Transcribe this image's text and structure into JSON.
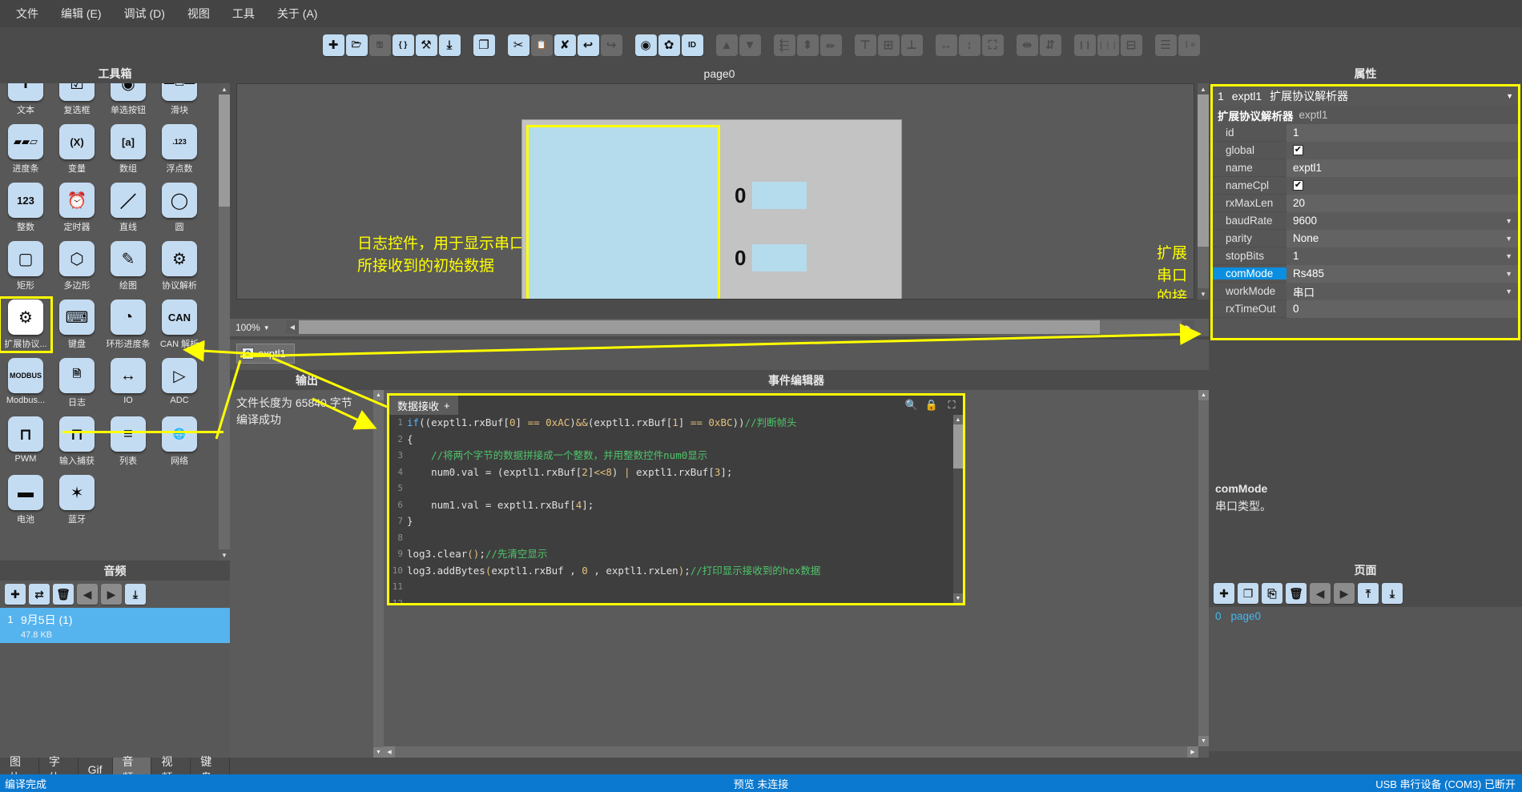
{
  "menubar": {
    "items": [
      "文件",
      "编辑 (E)",
      "调试 (D)",
      "视图",
      "工具",
      "关于 (A)"
    ]
  },
  "toolbar": {
    "buttons": [
      {
        "name": "new-icon",
        "glyph": "✚",
        "enabled": true
      },
      {
        "name": "open-folder-icon",
        "glyph": "🗁",
        "enabled": true
      },
      {
        "name": "save-icon",
        "glyph": "🖫",
        "enabled": false
      },
      {
        "name": "braces-icon",
        "glyph": "{ }",
        "enabled": true
      },
      {
        "name": "build-icon",
        "glyph": "⚒",
        "enabled": true
      },
      {
        "name": "download-icon",
        "glyph": "⤓",
        "enabled": true
      },
      {
        "name": "copy-icon",
        "glyph": "❐",
        "enabled": true
      },
      {
        "name": "cut-icon",
        "glyph": "✂",
        "enabled": true
      },
      {
        "name": "paste-icon",
        "glyph": "📋",
        "enabled": false
      },
      {
        "name": "delete-icon",
        "glyph": "✘",
        "enabled": true
      },
      {
        "name": "undo-icon",
        "glyph": "↩",
        "enabled": true
      },
      {
        "name": "redo-icon",
        "glyph": "↪",
        "enabled": false
      },
      {
        "name": "preview-icon",
        "glyph": "◉",
        "enabled": true
      },
      {
        "name": "settings-gear-icon",
        "glyph": "✿",
        "enabled": true
      },
      {
        "name": "id-icon",
        "glyph": "ID",
        "enabled": true
      },
      {
        "name": "move-up-icon",
        "glyph": "▲",
        "enabled": false
      },
      {
        "name": "move-down-icon",
        "glyph": "▼",
        "enabled": false
      },
      {
        "name": "align-left-icon",
        "glyph": "⬱",
        "enabled": false
      },
      {
        "name": "align-center-h-icon",
        "glyph": "⬍",
        "enabled": false
      },
      {
        "name": "align-right-icon",
        "glyph": "⬰",
        "enabled": false
      },
      {
        "name": "align-top-icon",
        "glyph": "⊤",
        "enabled": false
      },
      {
        "name": "align-middle-v-icon",
        "glyph": "⊞",
        "enabled": false
      },
      {
        "name": "align-bottom-icon",
        "glyph": "⊥",
        "enabled": false
      },
      {
        "name": "same-width-icon",
        "glyph": "↔",
        "enabled": false
      },
      {
        "name": "same-height-icon",
        "glyph": "↕",
        "enabled": false
      },
      {
        "name": "fit-size-icon",
        "glyph": "⛶",
        "enabled": false
      },
      {
        "name": "distribute-h-icon",
        "glyph": "⇹",
        "enabled": false
      },
      {
        "name": "distribute-v-icon",
        "glyph": "⇵",
        "enabled": false
      },
      {
        "name": "group-icon",
        "glyph": "❙❙",
        "enabled": false
      },
      {
        "name": "ungroup-icon",
        "glyph": "❘❘❘",
        "enabled": false
      },
      {
        "name": "lock-icon",
        "glyph": "⊟",
        "enabled": false
      },
      {
        "name": "list-order-icon",
        "glyph": "☰",
        "enabled": false
      },
      {
        "name": "list-number-icon",
        "glyph": "⋮≡",
        "enabled": false
      }
    ]
  },
  "toolbox": {
    "title": "工具箱",
    "items": [
      {
        "label": "文本",
        "glyph": "T",
        "selected": false
      },
      {
        "label": "复选框",
        "glyph": "☑",
        "selected": false
      },
      {
        "label": "单选按钮",
        "glyph": "◉",
        "selected": false
      },
      {
        "label": "滑块",
        "glyph": "—▭—",
        "selected": false
      },
      {
        "label": "进度条",
        "glyph": "▰▰▱",
        "selected": false
      },
      {
        "label": "变量",
        "glyph": "(X)",
        "selected": false
      },
      {
        "label": "数组",
        "glyph": "[a]",
        "selected": false
      },
      {
        "label": "浮点数",
        "glyph": ".123",
        "selected": false
      },
      {
        "label": "整数",
        "glyph": "123",
        "selected": false
      },
      {
        "label": "定时器",
        "glyph": "⏰",
        "selected": false
      },
      {
        "label": "直线",
        "glyph": "／",
        "selected": false
      },
      {
        "label": "圆",
        "glyph": "◯",
        "selected": false
      },
      {
        "label": "矩形",
        "glyph": "▢",
        "selected": false
      },
      {
        "label": "多边形",
        "glyph": "⬡",
        "selected": false
      },
      {
        "label": "绘图",
        "glyph": "✎",
        "selected": false
      },
      {
        "label": "协议解析",
        "glyph": "⚙",
        "selected": false
      },
      {
        "label": "扩展协议...",
        "glyph": "⚙",
        "selected": true
      },
      {
        "label": "键盘",
        "glyph": "⌨",
        "selected": false
      },
      {
        "label": "环形进度条",
        "glyph": "◔",
        "selected": false
      },
      {
        "label": "CAN 解析",
        "glyph": "CAN",
        "selected": false
      },
      {
        "label": "Modbus...",
        "glyph": "MODBUS",
        "selected": false
      },
      {
        "label": "日志",
        "glyph": "🗎",
        "selected": false
      },
      {
        "label": "IO",
        "glyph": "↔",
        "selected": false
      },
      {
        "label": "ADC",
        "glyph": "▷",
        "selected": false
      },
      {
        "label": "PWM",
        "glyph": "⊓",
        "selected": false
      },
      {
        "label": "输入捕获",
        "glyph": "⊓",
        "selected": false
      },
      {
        "label": "列表",
        "glyph": "≡",
        "selected": false
      },
      {
        "label": "网络",
        "glyph": "🌐",
        "selected": false
      },
      {
        "label": "电池",
        "glyph": "▬",
        "selected": false
      },
      {
        "label": "蓝牙",
        "glyph": "✶",
        "selected": false
      }
    ]
  },
  "audio": {
    "title": "音频",
    "buttons": [
      {
        "name": "add-audio-button",
        "glyph": "✚",
        "gray": false
      },
      {
        "name": "replace-audio-button",
        "glyph": "⇄",
        "gray": false
      },
      {
        "name": "delete-audio-button",
        "glyph": "🗑",
        "gray": false
      },
      {
        "name": "move-prev-button",
        "glyph": "◀",
        "gray": true
      },
      {
        "name": "move-next-button",
        "glyph": "▶",
        "gray": true
      },
      {
        "name": "export-audio-button",
        "glyph": "⤓",
        "gray": false
      }
    ],
    "items": [
      {
        "index": "1",
        "name": "9月5日 (1)",
        "size": "47.8 KB",
        "selected": true
      }
    ]
  },
  "asset_tabs": {
    "items": [
      "图片",
      "字体",
      "Gif",
      "音频",
      "视频",
      "键盘"
    ],
    "active": "音频"
  },
  "canvas": {
    "title": "page0",
    "zoom": "100%",
    "annotation_left": "日志控件，用于显示串口\n所接收到的初始数据",
    "annotation_right": "扩展串口的接口设置在控件属性内\n主串口的接口设置在项目设置内",
    "num0_value": "0",
    "num1_value": "0",
    "object_chip": "exptl1"
  },
  "output": {
    "title": "输出",
    "lines": [
      "文件长度为 65840 字节",
      "编译成功"
    ]
  },
  "events": {
    "title": "事件编辑器",
    "tab_label": "数据接收",
    "tab_add": "+",
    "tools": [
      {
        "name": "search-icon",
        "glyph": "🔍"
      },
      {
        "name": "lock-icon",
        "glyph": "🔒"
      },
      {
        "name": "expand-icon",
        "glyph": "⛶"
      }
    ],
    "code_lines": [
      {
        "n": "1",
        "tokens": [
          {
            "t": "kw",
            "v": "if"
          },
          {
            "t": "txt",
            "v": "(("
          },
          {
            "t": "txt",
            "v": "exptl1.rxBuf["
          },
          {
            "t": "num",
            "v": "0"
          },
          {
            "t": "txt",
            "v": "] "
          },
          {
            "t": "op",
            "v": "=="
          },
          {
            "t": "txt",
            "v": " "
          },
          {
            "t": "num",
            "v": "0xAC"
          },
          {
            "t": "txt",
            "v": ")"
          },
          {
            "t": "op",
            "v": "&&"
          },
          {
            "t": "txt",
            "v": "(exptl1.rxBuf["
          },
          {
            "t": "num",
            "v": "1"
          },
          {
            "t": "txt",
            "v": "] "
          },
          {
            "t": "op",
            "v": "=="
          },
          {
            "t": "txt",
            "v": " "
          },
          {
            "t": "num",
            "v": "0xBC"
          },
          {
            "t": "txt",
            "v": "))"
          },
          {
            "t": "cmt",
            "v": "//判断帧头"
          }
        ]
      },
      {
        "n": "2",
        "tokens": [
          {
            "t": "txt",
            "v": "{"
          }
        ]
      },
      {
        "n": "3",
        "tokens": [
          {
            "t": "cmt",
            "v": "    //将两个字节的数据拼接成一个整数，并用整数控件num0显示"
          }
        ]
      },
      {
        "n": "4",
        "tokens": [
          {
            "t": "txt",
            "v": "    num0.val = (exptl1.rxBuf["
          },
          {
            "t": "num",
            "v": "2"
          },
          {
            "t": "txt",
            "v": "]"
          },
          {
            "t": "op",
            "v": "<<"
          },
          {
            "t": "num",
            "v": "8"
          },
          {
            "t": "txt",
            "v": ") "
          },
          {
            "t": "op",
            "v": "|"
          },
          {
            "t": "txt",
            "v": " exptl1.rxBuf["
          },
          {
            "t": "num",
            "v": "3"
          },
          {
            "t": "txt",
            "v": "];"
          }
        ]
      },
      {
        "n": "5",
        "tokens": []
      },
      {
        "n": "6",
        "tokens": [
          {
            "t": "txt",
            "v": "    num1.val = exptl1.rxBuf["
          },
          {
            "t": "num",
            "v": "4"
          },
          {
            "t": "txt",
            "v": "];"
          }
        ]
      },
      {
        "n": "7",
        "tokens": [
          {
            "t": "txt",
            "v": "}"
          }
        ]
      },
      {
        "n": "8",
        "tokens": []
      },
      {
        "n": "9",
        "tokens": [
          {
            "t": "txt",
            "v": "log3.clear"
          },
          {
            "t": "op",
            "v": "()"
          },
          {
            "t": "txt",
            "v": ";"
          },
          {
            "t": "cmt",
            "v": "//先清空显示"
          }
        ]
      },
      {
        "n": "10",
        "tokens": [
          {
            "t": "txt",
            "v": "log3.addBytes"
          },
          {
            "t": "op",
            "v": "("
          },
          {
            "t": "txt",
            "v": "exptl1.rxBuf , "
          },
          {
            "t": "num",
            "v": "0"
          },
          {
            "t": "txt",
            "v": " , exptl1.rxLen"
          },
          {
            "t": "op",
            "v": ")"
          },
          {
            "t": "txt",
            "v": ";"
          },
          {
            "t": "cmt",
            "v": "//打印显示接收到的hex数据"
          }
        ]
      },
      {
        "n": "11",
        "tokens": []
      },
      {
        "n": "12",
        "tokens": []
      },
      {
        "n": "13",
        "tokens": []
      }
    ]
  },
  "properties": {
    "title": "属性",
    "selected_id": "1",
    "selected_name": "exptl1",
    "selected_type": "扩展协议解析器",
    "header_type": "扩展协议解析器",
    "header_name": "exptl1",
    "rows": [
      {
        "key": "id",
        "value": "1",
        "type": "text",
        "selected": false
      },
      {
        "key": "global",
        "value": "✔",
        "type": "checkbox",
        "selected": false
      },
      {
        "key": "name",
        "value": "exptl1",
        "type": "text",
        "selected": false
      },
      {
        "key": "nameCpl",
        "value": "✔",
        "type": "checkbox",
        "selected": false
      },
      {
        "key": "rxMaxLen",
        "value": "20",
        "type": "text",
        "selected": false
      },
      {
        "key": "baudRate",
        "value": "9600",
        "type": "combo",
        "selected": false
      },
      {
        "key": "parity",
        "value": "None",
        "type": "combo",
        "selected": false
      },
      {
        "key": "stopBits",
        "value": "1",
        "type": "combo",
        "selected": false
      },
      {
        "key": "comMode",
        "value": "Rs485",
        "type": "combo",
        "selected": true
      },
      {
        "key": "workMode",
        "value": "串口",
        "type": "combo",
        "selected": false
      },
      {
        "key": "rxTimeOut",
        "value": "0",
        "type": "text",
        "selected": false
      }
    ],
    "help_title": "comMode",
    "help_text": "串口类型。"
  },
  "pages": {
    "title": "页面",
    "buttons": [
      {
        "name": "add-page-button",
        "glyph": "✚",
        "gray": false
      },
      {
        "name": "copy-page-button",
        "glyph": "❐",
        "gray": false
      },
      {
        "name": "paste-page-button",
        "glyph": "⎘",
        "gray": false
      },
      {
        "name": "delete-page-button",
        "glyph": "🗑",
        "gray": false
      },
      {
        "name": "page-prev-button",
        "glyph": "◀",
        "gray": true
      },
      {
        "name": "page-next-button",
        "glyph": "▶",
        "gray": true
      },
      {
        "name": "import-page-button",
        "glyph": "⤒",
        "gray": false
      },
      {
        "name": "export-page-button",
        "glyph": "⤓",
        "gray": false
      }
    ],
    "items": [
      {
        "index": "0",
        "name": "page0"
      }
    ]
  },
  "statusbar": {
    "left": "编译完成",
    "center": "预览 未连接",
    "right": "USB 串行设备 (COM3) 已断开"
  },
  "colors": {
    "accent_yellow": "#ffff00",
    "status_blue": "#0b79d0",
    "selection_blue": "#0a8fe0",
    "icon_bg": "#c4dcf2",
    "panel_bg": "#585858"
  }
}
